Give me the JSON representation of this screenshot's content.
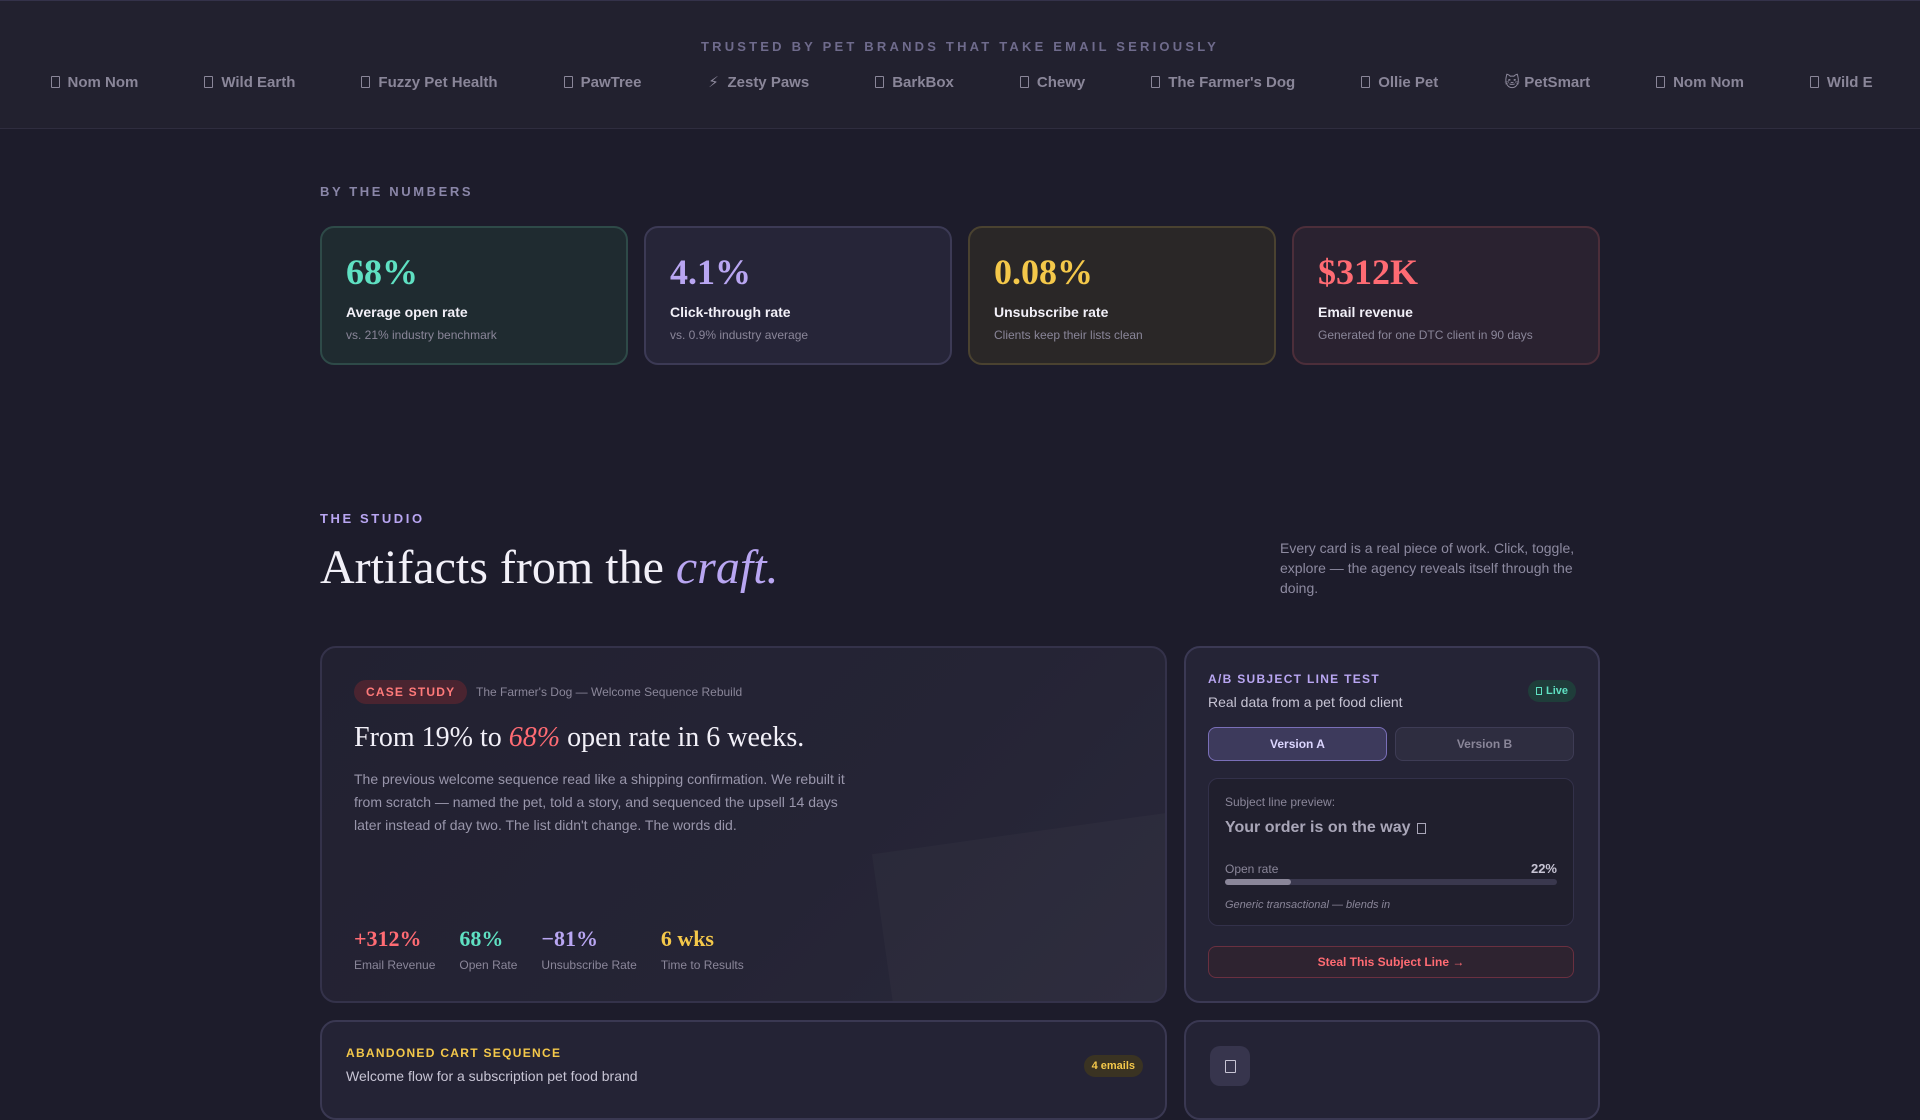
{
  "trusted": {
    "label": "TRUSTED BY PET BRANDS THAT TAKE EMAIL SERIOUSLY",
    "brands": [
      {
        "name": "PetSmart",
        "shown": "mart",
        "icon": "box-icon"
      },
      {
        "name": "Nom Nom",
        "icon": "box-icon"
      },
      {
        "name": "Wild Earth",
        "icon": "box-icon"
      },
      {
        "name": "Fuzzy Pet Health",
        "icon": "box-icon"
      },
      {
        "name": "PawTree",
        "icon": "box-icon"
      },
      {
        "name": "Zesty Paws",
        "icon": "lightning-icon"
      },
      {
        "name": "BarkBox",
        "icon": "box-icon"
      },
      {
        "name": "Chewy",
        "icon": "box-icon"
      },
      {
        "name": "The Farmer's Dog",
        "icon": "box-icon"
      },
      {
        "name": "Ollie Pet",
        "icon": "box-icon"
      },
      {
        "name": "PetSmart",
        "icon": "cat-face-icon"
      },
      {
        "name": "Nom Nom",
        "icon": "box-icon"
      },
      {
        "name": "Wild Earth",
        "shown": "Wild E",
        "icon": "box-icon"
      }
    ]
  },
  "numbers": {
    "eyebrow": "BY THE NUMBERS",
    "stats": [
      {
        "value": "68%",
        "label": "Average open rate",
        "sub": "vs. 21% industry benchmark",
        "color": "#5fe0c2"
      },
      {
        "value": "4.1%",
        "label": "Click-through rate",
        "sub": "vs. 0.9% industry average",
        "color": "#b9a6f2"
      },
      {
        "value": "0.08%",
        "label": "Unsubscribe rate",
        "sub": "Clients keep their lists clean",
        "color": "#f4c84a"
      },
      {
        "value": "$312K",
        "label": "Email revenue",
        "sub": "Generated for one DTC client in 90 days",
        "color": "#ff6b73"
      }
    ]
  },
  "studio": {
    "eyebrow": "THE STUDIO",
    "title_pre": "Artifacts from the ",
    "title_em": "craft.",
    "description": "Every card is a real piece of work. Click, toggle, explore — the agency reveals itself through the doing."
  },
  "case_study": {
    "pill": "CASE STUDY",
    "subtitle": "The Farmer's Dog — Welcome Sequence Rebuild",
    "headline_pre": "From 19% to ",
    "headline_em": "68%",
    "headline_post": " open rate in 6 weeks.",
    "body": "The previous welcome sequence read like a shipping confirmation. We rebuilt it from scratch — named the pet, told a story, and sequenced the upsell 14 days later instead of day two. The list didn't change. The words did.",
    "metrics": [
      {
        "value": "+312%",
        "label": "Email Revenue",
        "color": "#ff6b73"
      },
      {
        "value": "68%",
        "label": "Open Rate",
        "color": "#5fe0c2"
      },
      {
        "value": "−81%",
        "label": "Unsubscribe Rate",
        "color": "#b9a6f2"
      },
      {
        "value": "6 wks",
        "label": "Time to Results",
        "color": "#f4c84a"
      }
    ]
  },
  "ab_test": {
    "title": "A/B SUBJECT LINE TEST",
    "subtitle": "Real data from a pet food client",
    "badge": "Live",
    "version_a": "Version A",
    "version_b": "Version B",
    "preview_label": "Subject line preview:",
    "subject": "Your order is on the way",
    "rate_label": "Open rate",
    "rate_value": "22%",
    "rate_fraction": 0.2,
    "note": "Generic transactional — blends in",
    "cta": "Steal This Subject Line →"
  },
  "cart": {
    "title": "ABANDONED CART SEQUENCE",
    "subtitle": "Welcome flow for a subscription pet food brand",
    "badge": "4 emails"
  }
}
